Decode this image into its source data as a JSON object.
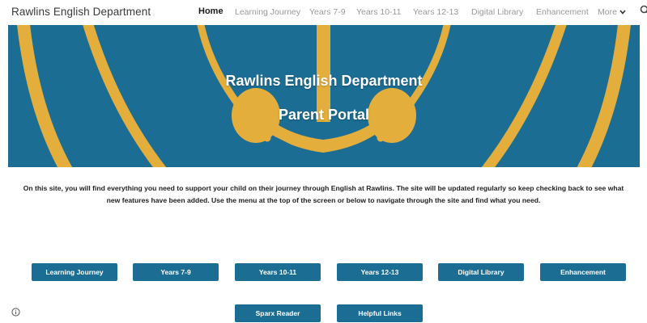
{
  "site": {
    "name": "Rawlins English Department"
  },
  "nav": {
    "items": [
      {
        "label": "Home",
        "active": true
      },
      {
        "label": "Learning Journey"
      },
      {
        "label": "Years 7-9"
      },
      {
        "label": "Years 10-11"
      },
      {
        "label": "Years 12-13"
      },
      {
        "label": "Digital Library"
      },
      {
        "label": "Enhancement"
      }
    ],
    "more_label": "More"
  },
  "hero": {
    "title": "Rawlins English Department",
    "subtitle": "Parent Portal",
    "colors": {
      "background": "#1c6d93",
      "art": "#e4ae3c"
    }
  },
  "intro": {
    "text": "On this site, you will find everything you need to support your child on their journey through English at Rawlins. The site will be updated regularly so keep checking back to see what new features have been added. Use the menu at the top of the screen or below to navigate through the site and find what you need."
  },
  "buttons": {
    "row1": [
      "Learning Journey",
      "Years 7-9",
      "Years 10-11",
      "Years 12-13",
      "Digital Library",
      "Enhancement"
    ],
    "row2": [
      "Sparx Reader",
      "Helpful Links"
    ]
  },
  "icons": {
    "search": "search-icon",
    "info": "info-icon",
    "more": "chevron-down-icon"
  }
}
